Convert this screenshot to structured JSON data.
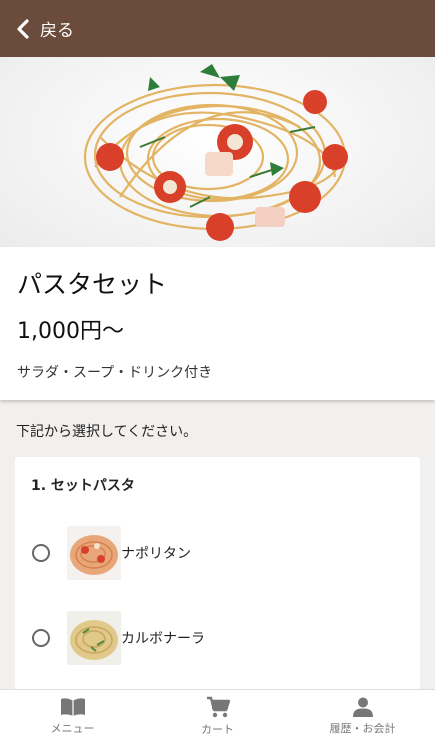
{
  "header": {
    "back_label": "戻る",
    "back_icon": "chevron-left-icon"
  },
  "product": {
    "title": "パスタセット",
    "price": "1,000円〜",
    "description": "サラダ・スープ・ドリンク付き"
  },
  "instruction": "下記から選択してください。",
  "section": {
    "title": "1. セットパスタ",
    "options": [
      {
        "label": "ナポリタン",
        "selected": false
      },
      {
        "label": "カルボナーラ",
        "selected": false
      }
    ]
  },
  "bottom_nav": [
    {
      "label": "メニュー",
      "icon": "book-icon"
    },
    {
      "label": "カート",
      "icon": "cart-icon"
    },
    {
      "label": "履歴・お会計",
      "icon": "person-icon"
    }
  ],
  "colors": {
    "header_bg": "#6b4c3c",
    "page_bg": "#f2f0ee"
  }
}
